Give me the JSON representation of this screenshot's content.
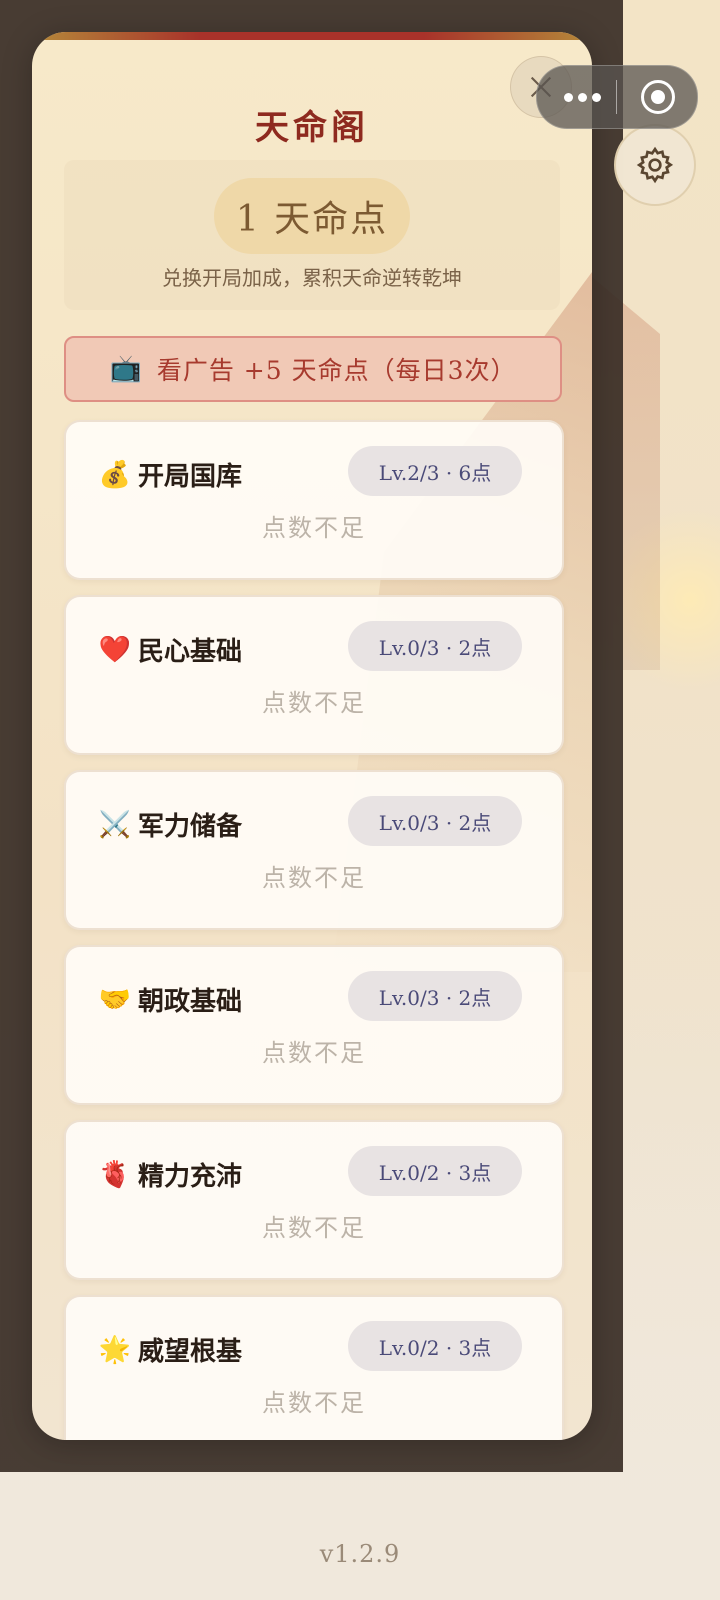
{
  "capsule": {
    "more_icon": "ellipsis-icon",
    "target_icon": "target-icon"
  },
  "settings": {
    "icon": "gear-icon"
  },
  "modal": {
    "title": "天命阁",
    "close_icon": "close-icon",
    "points": {
      "value_label": "1 天命点",
      "description": "兑换开局加成，累积天命逆转乾坤"
    },
    "ad_button": {
      "icon": "📺",
      "label": "看广告 +5 天命点（每日3次）"
    },
    "items": [
      {
        "icon": "💰",
        "icon_name": "money-bag-icon",
        "name": "开局国库",
        "level": "Lv.2/3 · 6点",
        "status": "点数不足"
      },
      {
        "icon": "❤️",
        "icon_name": "heart-icon",
        "name": "民心基础",
        "level": "Lv.0/3 · 2点",
        "status": "点数不足"
      },
      {
        "icon": "⚔️",
        "icon_name": "crossed-swords-icon",
        "name": "军力储备",
        "level": "Lv.0/3 · 2点",
        "status": "点数不足"
      },
      {
        "icon": "🤝",
        "icon_name": "handshake-icon",
        "name": "朝政基础",
        "level": "Lv.0/3 · 2点",
        "status": "点数不足"
      },
      {
        "icon": "🫀",
        "icon_name": "anatomical-heart-icon",
        "name": "精力充沛",
        "level": "Lv.0/2 · 3点",
        "status": "点数不足"
      },
      {
        "icon": "🌟",
        "icon_name": "glowing-star-icon",
        "name": "威望根基",
        "level": "Lv.0/2 · 3点",
        "status": "点数不足"
      }
    ]
  },
  "footer": {
    "version": "v1.2.9"
  },
  "colors": {
    "title": "#8e2a1f",
    "ad_text": "#a73a2e",
    "level_text": "#4a4a78",
    "status_text": "#bcb3a8"
  }
}
